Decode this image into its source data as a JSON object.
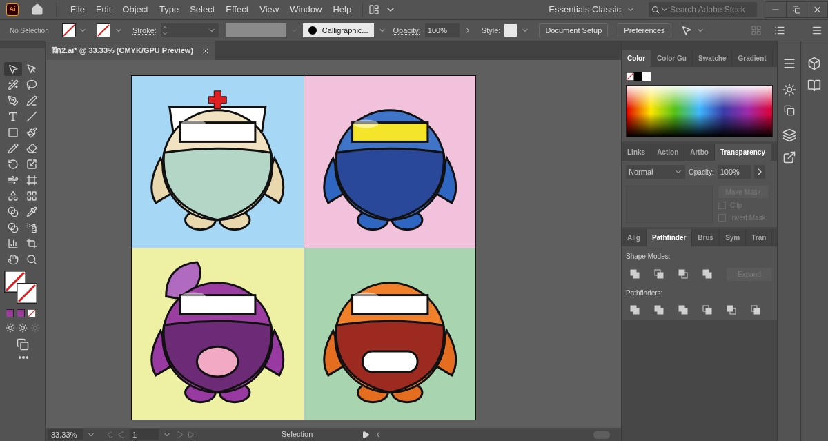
{
  "menu": {
    "logo": "Ai",
    "items": [
      "File",
      "Edit",
      "Object",
      "Type",
      "Select",
      "Effect",
      "View",
      "Window",
      "Help"
    ],
    "workspace": "Essentials Classic",
    "search": {
      "placeholder": "Search Adobe Stock"
    }
  },
  "control_bar": {
    "selection": "No Selection",
    "stroke_label": "Stroke:",
    "brush": "Calligraphic...",
    "opacity_label": "Opacity:",
    "opacity_value": "100%",
    "style_label": "Style:",
    "buttons": [
      "Document Setup",
      "Preferences"
    ]
  },
  "tools": [
    {
      "selected": true
    },
    {
      "selected": false
    },
    {
      "selected": false
    },
    {
      "selected": false
    },
    {
      "selected": false
    },
    {
      "selected": false
    },
    {
      "selected": false
    },
    {
      "selected": false
    },
    {
      "selected": false
    },
    {
      "selected": false
    },
    {
      "selected": false
    },
    {
      "selected": false
    },
    {
      "selected": false
    },
    {
      "selected": false
    },
    {
      "selected": false
    },
    {
      "selected": false
    },
    {
      "selected": false
    },
    {
      "selected": false
    },
    {
      "selected": false
    },
    {
      "selected": false
    },
    {
      "selected": false
    },
    {
      "selected": false
    },
    {
      "selected": false
    },
    {
      "selected": false
    },
    {
      "selected": false
    },
    {
      "selected": false
    }
  ],
  "document": {
    "tab_title": "ฝึก2.ai* @ 33.33% (CMYK/GPU Preview)"
  },
  "color_panel": {
    "tabs": [
      {
        "label": "Color",
        "selected": true
      },
      {
        "label": "Color Gu",
        "selected": false
      },
      {
        "label": "Swatche",
        "selected": false
      },
      {
        "label": "Gradient",
        "selected": false
      }
    ]
  },
  "transparency_panel": {
    "tabs": [
      {
        "label": "Links",
        "selected": false
      },
      {
        "label": "Action",
        "selected": false
      },
      {
        "label": "Artbo",
        "selected": false
      },
      {
        "label": "Transparency",
        "selected": true
      }
    ],
    "blend_mode": "Normal",
    "opacity_label": "Opacity:",
    "opacity_value": "100%",
    "make_mask": {
      "label": "Make Mask",
      "disabled": true
    },
    "options": [
      {
        "label": "Clip",
        "checked": false,
        "disabled": true
      },
      {
        "label": "Invert Mask",
        "checked": false,
        "disabled": true
      }
    ]
  },
  "pathfinder_panel": {
    "tabs": [
      {
        "label": "Alig",
        "selected": false
      },
      {
        "label": "Pathfinder",
        "selected": true
      },
      {
        "label": "Brus",
        "selected": false
      },
      {
        "label": "Sym",
        "selected": false
      },
      {
        "label": "Tran",
        "selected": false
      }
    ],
    "shape_modes_label": "Shape Modes:",
    "expand": {
      "label": "Expand",
      "disabled": true
    },
    "pathfinders_label": "Pathfinders:"
  },
  "status_bar": {
    "zoom": "33.33%",
    "artboard": "1",
    "tool": "Selection"
  }
}
